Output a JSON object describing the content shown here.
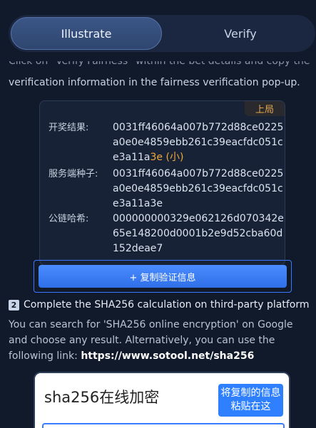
{
  "tabs": [
    {
      "label": "Illustrate",
      "active": true
    },
    {
      "label": "Verify",
      "active": false
    }
  ],
  "intro": {
    "cut_line": "Click on \"Verify Fairness\" within the bet details and copy the",
    "line": "verification information in the fairness verification pop-up."
  },
  "card": {
    "badge": "上局",
    "rows": [
      {
        "label": "开奖结果:",
        "value_main": "0031ff46064a007b772d88ce0225a0e0e4859ebb261c39eacfdc051ce3a11a",
        "value_highlight": "3e",
        "value_suffix": " (小)"
      },
      {
        "label": "服务端种子:",
        "value": "0031ff46064a007b772d88ce0225a0e0e4859ebb261c39eacfdc051ce3a11a3e"
      },
      {
        "label": "公链哈希:",
        "value": "000000000329e062126d070342e65e148200d0001b2e9d52cba60d152deae7"
      }
    ],
    "copy_button": "+ 复制验证信息"
  },
  "step2": {
    "number": "2",
    "title": "Complete the SHA256 calculation on third-party platform",
    "text": "You can search for 'SHA256 online encryption' on Google and choose any result. Alternatively, you can use the following link: ",
    "link": "https://www.sotool.net/sha256"
  },
  "example": {
    "title": "sha256在线加密",
    "tip": "将复制的信息粘贴在这"
  },
  "colors": {
    "background": "#101a2b",
    "accent": "#3c78ff",
    "highlight": "#f0a93b"
  }
}
